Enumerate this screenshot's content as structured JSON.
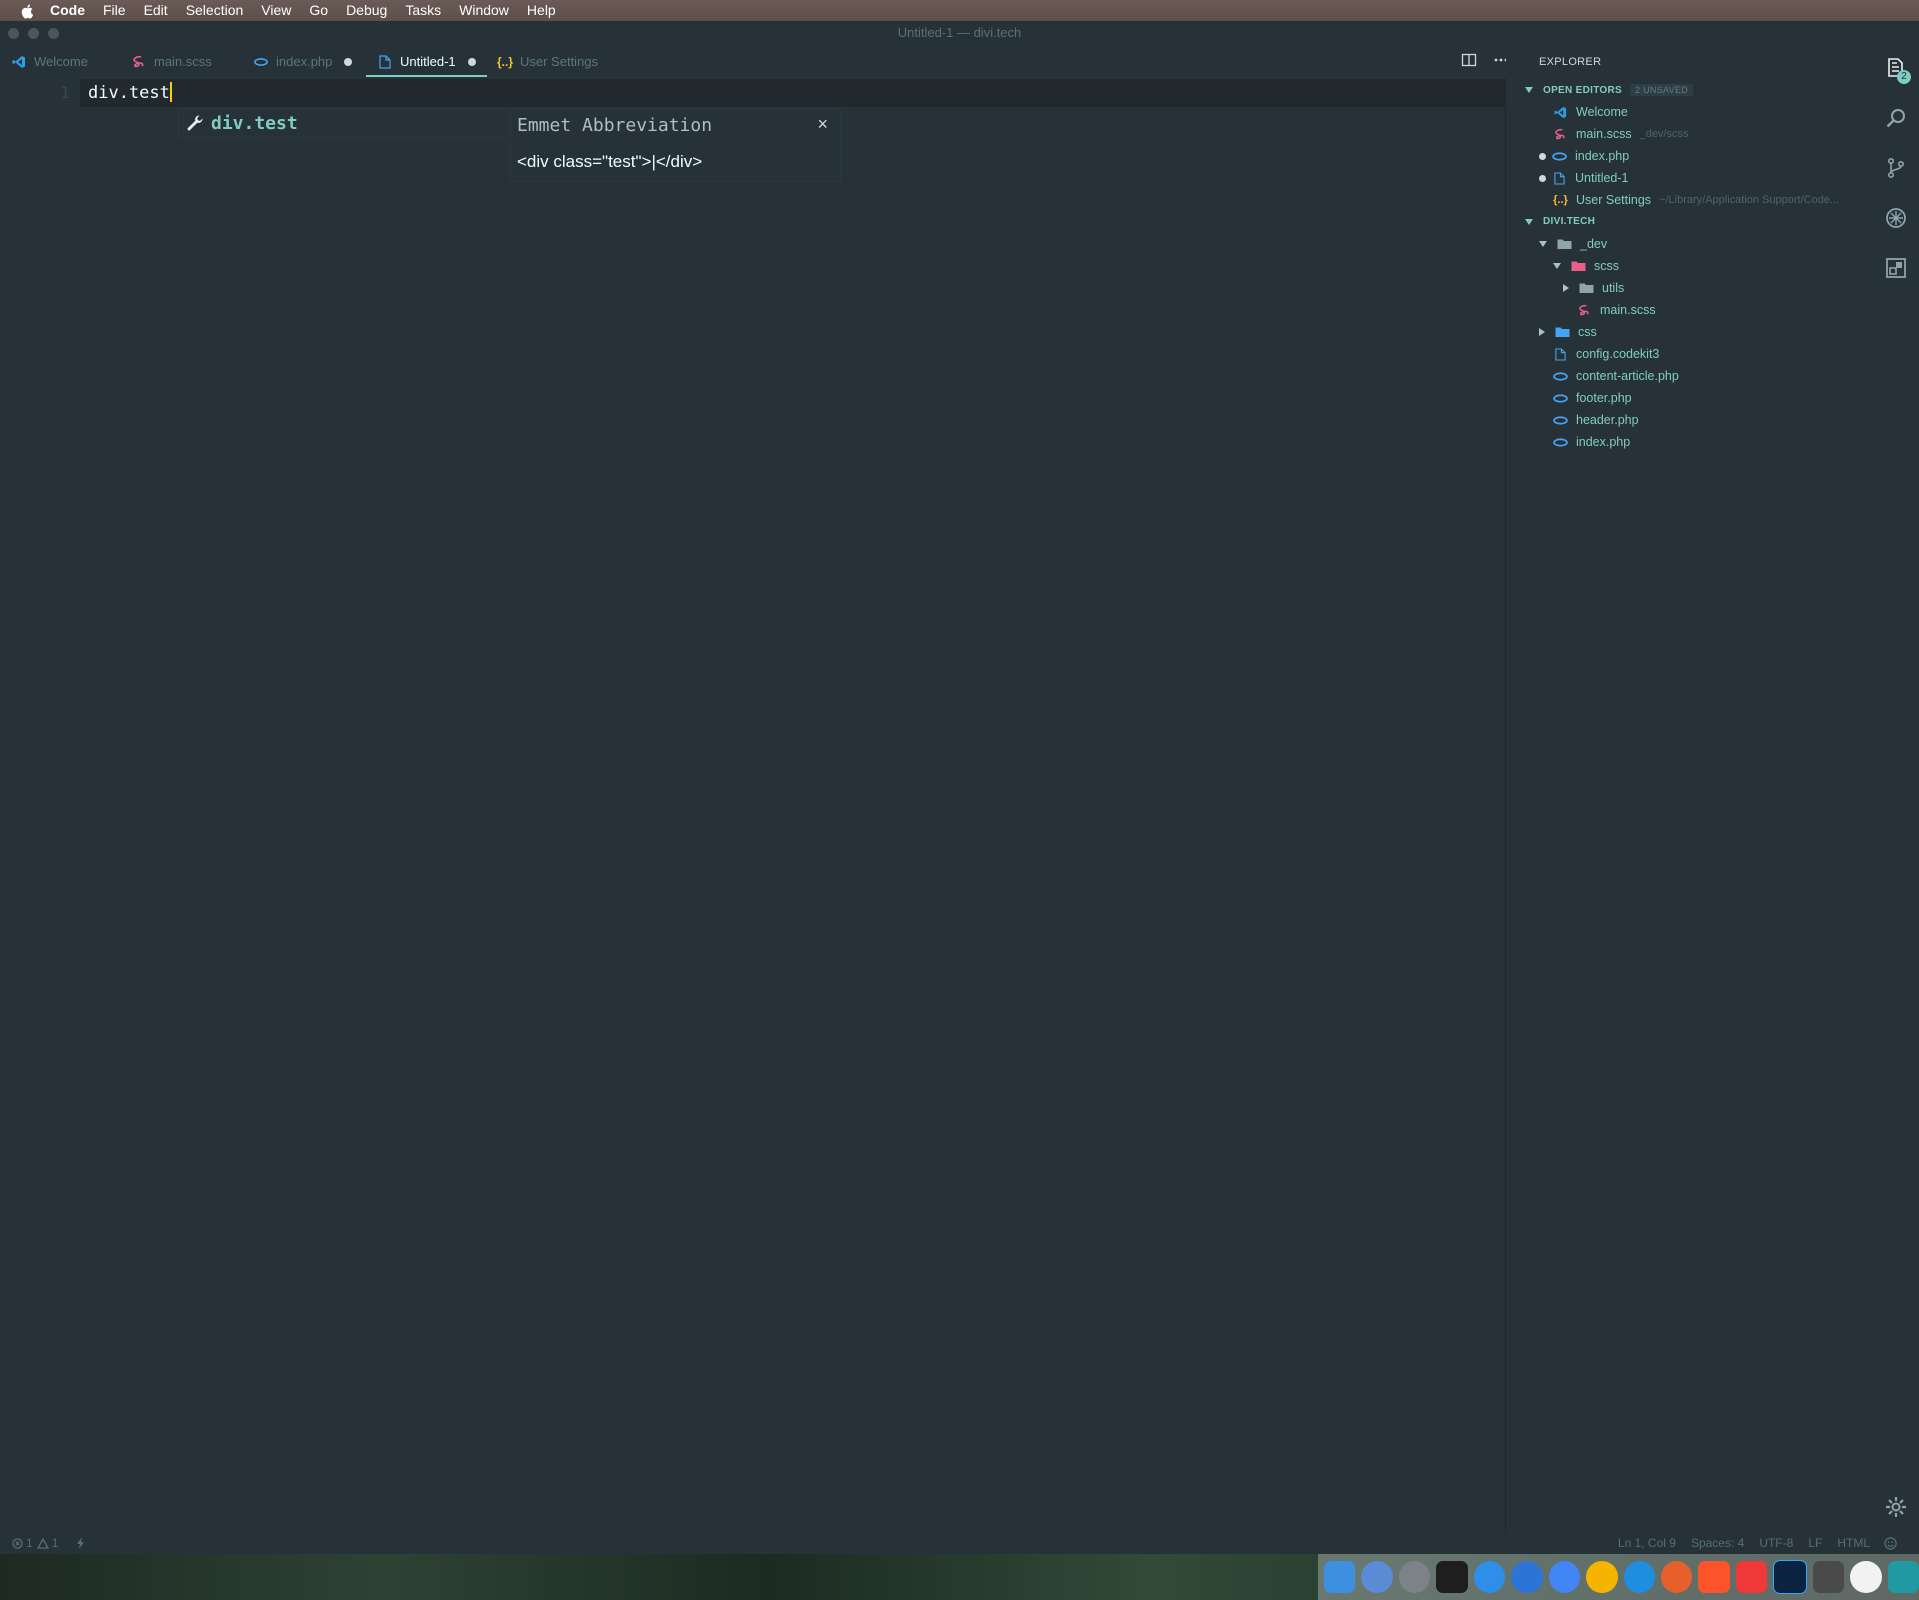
{
  "menubar": {
    "items": [
      "Code",
      "File",
      "Edit",
      "Selection",
      "View",
      "Go",
      "Debug",
      "Tasks",
      "Window",
      "Help"
    ]
  },
  "window": {
    "title": "Untitled-1 — divi.tech"
  },
  "tabs": [
    {
      "label": "Welcome",
      "icon": "vscode-icon",
      "dirty": false,
      "active": false
    },
    {
      "label": "main.scss",
      "icon": "sass-icon",
      "dirty": false,
      "active": false
    },
    {
      "label": "index.php",
      "icon": "php-icon",
      "dirty": true,
      "active": false
    },
    {
      "label": "Untitled-1",
      "icon": "file-icon",
      "dirty": true,
      "active": true
    },
    {
      "label": "User Settings",
      "icon": "json-icon",
      "dirty": false,
      "active": false
    }
  ],
  "editor": {
    "line_number": "1",
    "code": "div.test",
    "suggestion": {
      "label": "div.test",
      "icon": "wrench-icon"
    },
    "details": {
      "title": "Emmet Abbreviation",
      "body": "<div class=\"test\">|</div>",
      "close": "×"
    }
  },
  "sidebar": {
    "title": "EXPLORER",
    "open_editors": {
      "label": "OPEN EDITORS",
      "badge": "2 UNSAVED",
      "items": [
        {
          "label": "Welcome",
          "desc": "",
          "icon": "vscode-icon",
          "dirty": false
        },
        {
          "label": "main.scss",
          "desc": "_dev/scss",
          "icon": "sass-icon",
          "dirty": false
        },
        {
          "label": "index.php",
          "desc": "",
          "icon": "php-icon",
          "dirty": true
        },
        {
          "label": "Untitled-1",
          "desc": "",
          "icon": "file-icon",
          "dirty": true
        },
        {
          "label": "User Settings",
          "desc": "~/Library/Application Support/Code...",
          "icon": "json-icon",
          "dirty": false
        }
      ]
    },
    "folder": {
      "label": "DIVI.TECH",
      "tree": [
        {
          "label": "_dev",
          "type": "folder-open"
        },
        {
          "label": "scss",
          "type": "folder-open"
        },
        {
          "label": "utils",
          "type": "folder-closed"
        },
        {
          "label": "main.scss",
          "type": "sass"
        },
        {
          "label": "css",
          "type": "folder-closed"
        },
        {
          "label": "config.codekit3",
          "type": "file"
        },
        {
          "label": "content-article.php",
          "type": "php"
        },
        {
          "label": "footer.php",
          "type": "php"
        },
        {
          "label": "header.php",
          "type": "php"
        },
        {
          "label": "index.php",
          "type": "php"
        }
      ]
    }
  },
  "activity_bar": {
    "explorer_badge": "2",
    "icons": [
      "files-icon",
      "search-icon",
      "source-control-icon",
      "debug-icon",
      "extensions-icon",
      "settings-gear-icon"
    ]
  },
  "statusbar": {
    "errors": "1",
    "warnings": "1",
    "position": "Ln 1, Col 9",
    "spaces": "Spaces: 4",
    "encoding": "UTF-8",
    "eol": "LF",
    "language": "HTML"
  },
  "colors": {
    "background": "#263238",
    "accent": "#80cbc4",
    "cursor": "#ffcc00",
    "sass": "#ec5f8b",
    "php": "#42a5f5"
  }
}
